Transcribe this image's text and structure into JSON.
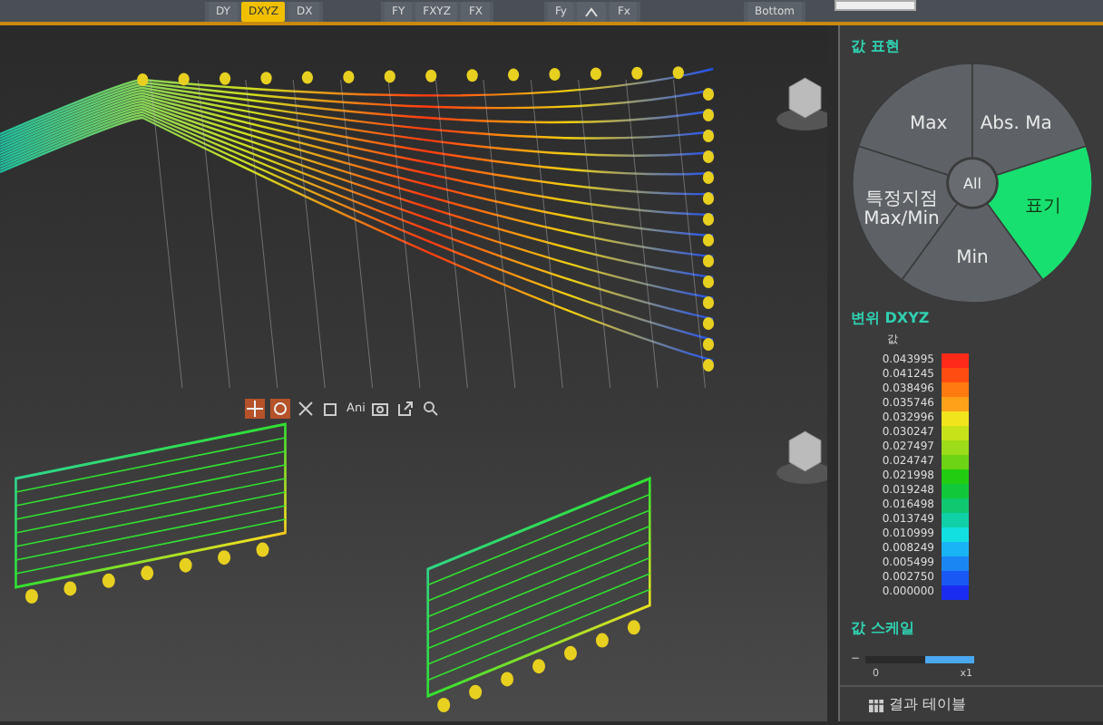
{
  "toolbar": {
    "groups": [
      [
        {
          "label": "DY",
          "selected": false
        },
        {
          "label": "DXYZ",
          "selected": true
        },
        {
          "label": "DX",
          "selected": false
        }
      ],
      [
        {
          "label": "FY",
          "selected": false
        },
        {
          "label": "FXYZ",
          "selected": false
        },
        {
          "label": "FX",
          "selected": false
        }
      ],
      [
        {
          "label": "Fy",
          "selected": false
        },
        {
          "label": "Fx",
          "selected": false
        }
      ],
      [
        {
          "label": "Bottom",
          "selected": false
        }
      ]
    ]
  },
  "view_toolbar": {
    "ani_label": "Ani"
  },
  "panel": {
    "display_title": "값 표현",
    "center_label": "All",
    "pie": [
      {
        "label": "Max",
        "selected": false
      },
      {
        "label": "Abs. Ma",
        "selected": false
      },
      {
        "label": "특정지점 Max/Min",
        "selected": false
      },
      {
        "label": "표기",
        "selected": true
      },
      {
        "label": "Min",
        "selected": false
      }
    ]
  },
  "legend": {
    "title": "변위 DXYZ",
    "header": "값",
    "entries": [
      {
        "value": "0.043995",
        "color": "#ff2a1a"
      },
      {
        "value": "0.041245",
        "color": "#ff4d12"
      },
      {
        "value": "0.038496",
        "color": "#ff7a10"
      },
      {
        "value": "0.035746",
        "color": "#ffa21a"
      },
      {
        "value": "0.032996",
        "color": "#f2e41c"
      },
      {
        "value": "0.030247",
        "color": "#c8e21a"
      },
      {
        "value": "0.027497",
        "color": "#9cdc18"
      },
      {
        "value": "0.024747",
        "color": "#6cd414"
      },
      {
        "value": "0.021998",
        "color": "#22cc10"
      },
      {
        "value": "0.019248",
        "color": "#10c83a"
      },
      {
        "value": "0.016498",
        "color": "#10c870"
      },
      {
        "value": "0.013749",
        "color": "#10d0a8"
      },
      {
        "value": "0.010999",
        "color": "#12e0e0"
      },
      {
        "value": "0.008249",
        "color": "#18b4f4"
      },
      {
        "value": "0.005499",
        "color": "#1a86f4"
      },
      {
        "value": "0.002750",
        "color": "#1a58f4"
      },
      {
        "value": "0.000000",
        "color": "#1a2cf0"
      }
    ]
  },
  "scale": {
    "title": "값 스케일",
    "minus": "−",
    "level": 0.45,
    "min_label": "0",
    "max_label": "x1"
  },
  "result_button": "결과 테이블"
}
